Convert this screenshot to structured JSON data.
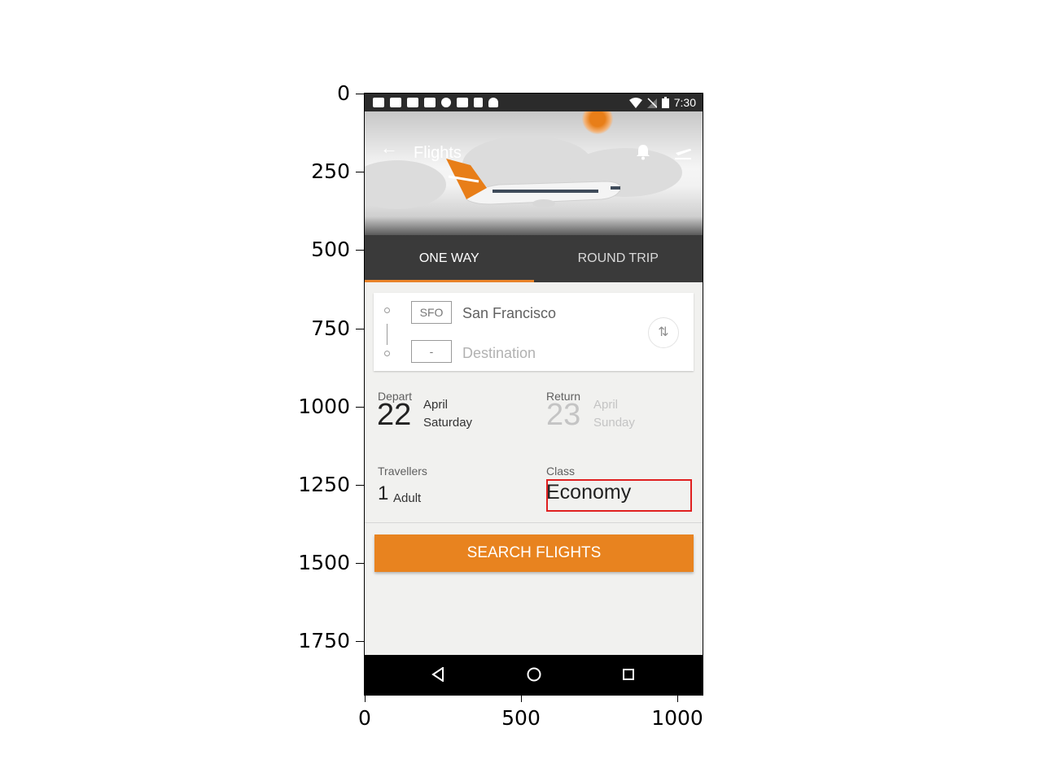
{
  "axes": {
    "y_ticks": [
      "0",
      "250",
      "500",
      "750",
      "1000",
      "1250",
      "1500",
      "1750"
    ],
    "x_ticks": [
      "0",
      "500",
      "1000"
    ]
  },
  "status_bar": {
    "time": "7:30",
    "icons": [
      "notification-icon",
      "facebook-icon",
      "nvidia-icon",
      "facebook-icon",
      "info-icon",
      "tools-icon",
      "lock-icon",
      "android-icon",
      "wifi-icon",
      "no-signal-icon",
      "battery-icon"
    ]
  },
  "header": {
    "title": "Flights",
    "icons": [
      "back-arrow-icon",
      "bell-icon",
      "flight-takeoff-icon"
    ]
  },
  "tabs": [
    {
      "label": "ONE WAY",
      "active": true
    },
    {
      "label": "ROUND TRIP",
      "active": false
    }
  ],
  "route": {
    "origin_code": "SFO",
    "origin_city": "San Francisco",
    "destination_code": "-",
    "destination_placeholder": "Destination",
    "swap_icon": "swap-vertical-icon"
  },
  "dates": {
    "depart": {
      "label": "Depart",
      "day": "22",
      "month": "April",
      "weekday": "Saturday"
    },
    "return": {
      "label": "Return",
      "day": "23",
      "month": "April",
      "weekday": "Sunday"
    }
  },
  "travellers": {
    "label": "Travellers",
    "count": "1",
    "unit": "Adult"
  },
  "class": {
    "label": "Class",
    "value": "Economy"
  },
  "search_button": "SEARCH FLIGHTS",
  "colors": {
    "accent": "#e8831f",
    "tab_bar": "#3a3a3a",
    "highlight_box": "#e02020"
  }
}
